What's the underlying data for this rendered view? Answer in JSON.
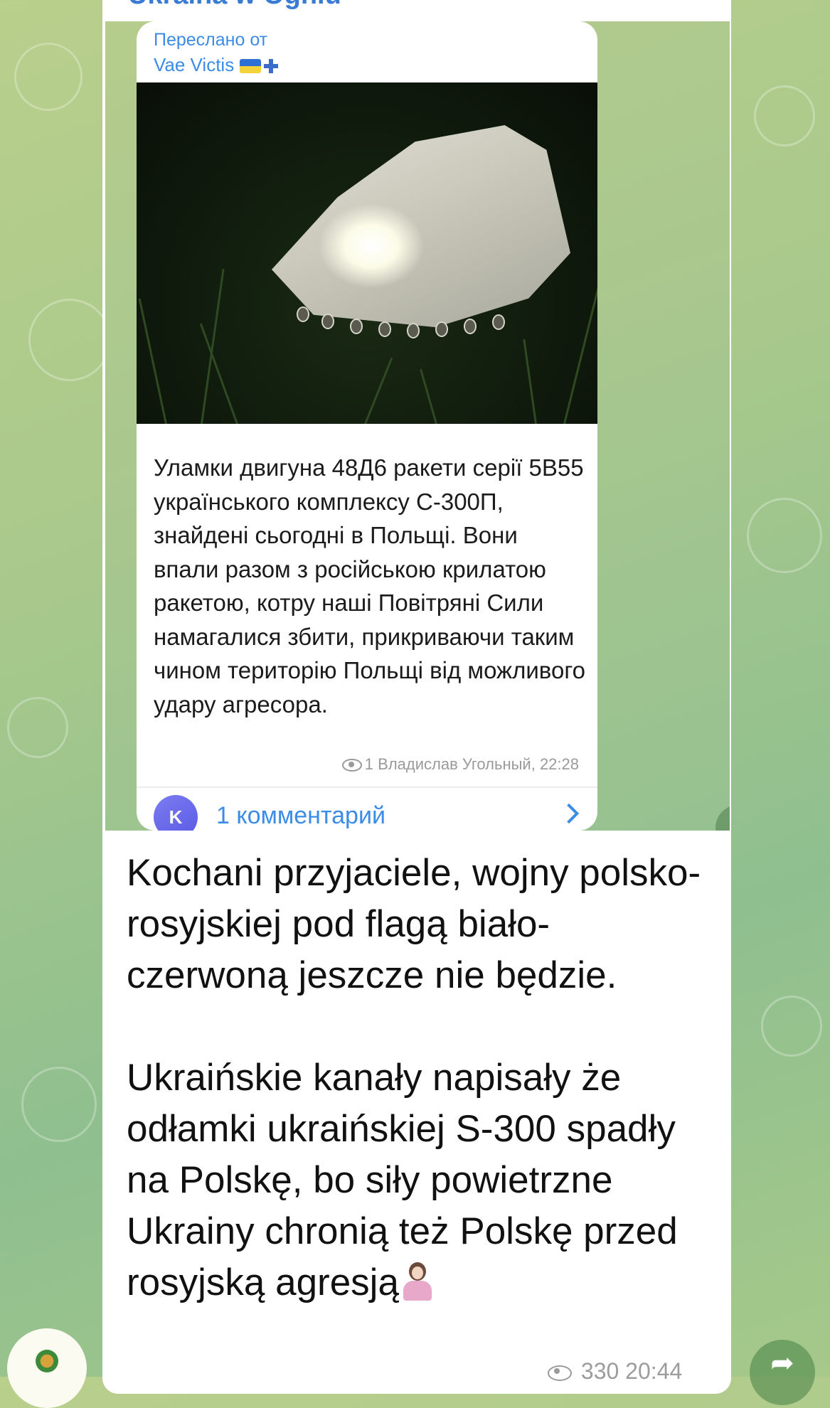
{
  "channel": {
    "name": "Ukraina w Ogniu"
  },
  "forwarded_screenshot": {
    "forward_label": "Переслано от",
    "forward_source": "Vae Victis",
    "caption": "Уламки двигуна 48Д6 ракети серії 5В55 українського комплексу С-300П, знайдені сьогодні в Польщі. Вони впали разом з російською крилатою ракетою, котру наші Повітряні Сили намагалися збити, прикриваючи таким чином територію Польщі від можливого удару агресора.",
    "meta": "1 Владислав Угольный, 22:28",
    "comment_avatar_letter": "K",
    "comment_label": "1 комментарий"
  },
  "message": {
    "paragraph1": "Kochani przyjaciele, wojny polsko-rosyjskiej pod flagą biało-czerwoną jeszcze nie będzie.",
    "paragraph2": "Ukraińskie kanały napisały że odłamki ukraińskiej S-300 spadły na Polskę, bo siły powietrzne Ukrainy chronią też Polskę przed rosyjską agresją",
    "views_time": "330 20:44"
  },
  "colors": {
    "link": "#3c8ce7",
    "bubble": "#ffffff",
    "wallpaper": "#a9c98c"
  },
  "icons": [
    "eye-icon",
    "share-icon",
    "chevron-right-icon",
    "flag-ukraine-icon",
    "cross-icon",
    "shrug-emoji"
  ]
}
